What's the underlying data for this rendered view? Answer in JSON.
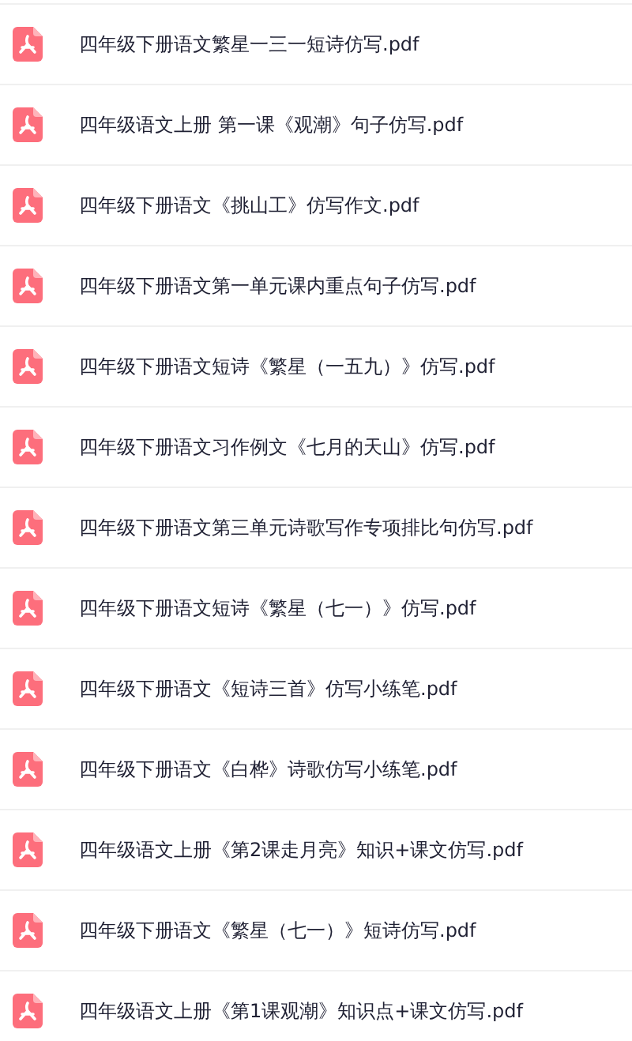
{
  "files": [
    {
      "name": "四年级下册语文繁星一三一短诗仿写.pdf"
    },
    {
      "name": "四年级语文上册 第一课《观潮》句子仿写.pdf"
    },
    {
      "name": "四年级下册语文《挑山工》仿写作文.pdf"
    },
    {
      "name": "四年级下册语文第一单元课内重点句子仿写.pdf"
    },
    {
      "name": "四年级下册语文短诗《繁星（一五九）》仿写.pdf"
    },
    {
      "name": "四年级下册语文习作例文《七月的天山》仿写.pdf"
    },
    {
      "name": "四年级下册语文第三单元诗歌写作专项排比句仿写.pdf"
    },
    {
      "name": "四年级下册语文短诗《繁星（七一）》仿写.pdf"
    },
    {
      "name": "四年级下册语文《短诗三首》仿写小练笔.pdf"
    },
    {
      "name": "四年级下册语文《白桦》诗歌仿写小练笔.pdf"
    },
    {
      "name": "四年级语文上册《第2课走月亮》知识+课文仿写.pdf"
    },
    {
      "name": "四年级下册语文《繁星（七一）》短诗仿写.pdf"
    },
    {
      "name": "四年级语文上册《第1课观潮》知识点+课文仿写.pdf"
    }
  ]
}
